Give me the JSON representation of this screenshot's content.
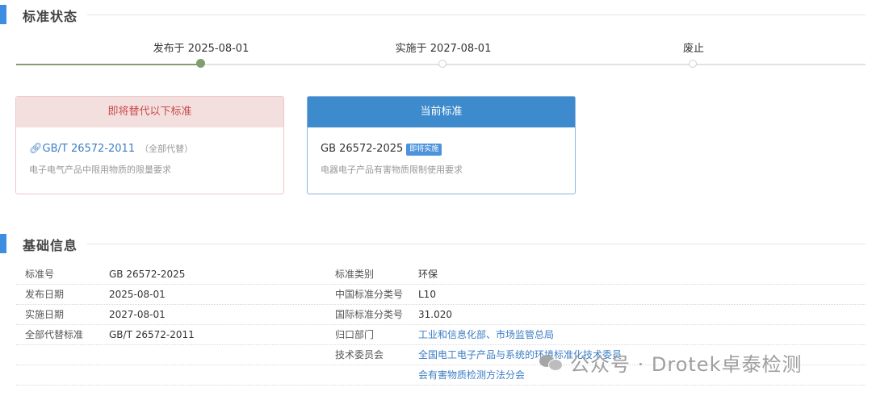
{
  "sections": {
    "status_title": "标准状态",
    "basic_title": "基础信息"
  },
  "timeline": {
    "steps": [
      {
        "label": "发布于 2025-08-01",
        "done": true
      },
      {
        "label": "实施于 2027-08-01",
        "done": false
      },
      {
        "label": "废止",
        "done": false
      }
    ]
  },
  "replace_card": {
    "header": "即将替代以下标准",
    "code": "GB/T 26572-2011",
    "note": "（全部代替）",
    "desc": "电子电气产品中限用物质的限量要求",
    "icon": "link-icon"
  },
  "current_card": {
    "header": "当前标准",
    "code": "GB 26572-2025",
    "badge": "即将实施",
    "desc": "电器电子产品有害物质限制使用要求"
  },
  "info": {
    "rows": [
      {
        "k1": "标准号",
        "v1": "GB 26572-2025",
        "k2": "标准类别",
        "v2": "环保"
      },
      {
        "k1": "发布日期",
        "v1": "2025-08-01",
        "k2": "中国标准分类号",
        "v2": "L10"
      },
      {
        "k1": "实施日期",
        "v1": "2027-08-01",
        "k2": "国际标准分类号",
        "v2": "31.020"
      },
      {
        "k1": "全部代替标准",
        "v1": "GB/T 26572-2011",
        "k2": "归口部门",
        "v2a": "工业和信息化部",
        "sep": "、",
        "v2b": "市场监管总局"
      },
      {
        "k1": "",
        "v1": "",
        "k2": "技术委员会",
        "v2": "全国电工电子产品与系统的环境标准化技术委员"
      },
      {
        "k1": "",
        "v1": "",
        "k2": "",
        "v2": "会有害物质检测方法分会"
      }
    ]
  },
  "watermark": {
    "text": "公众号 · Drotek卓泰检测",
    "icon": "wechat-icon"
  },
  "colors": {
    "accent": "#3d8ee0",
    "done": "#7f9f70",
    "replace_header_bg": "#f4dfdf",
    "replace_header_text": "#c94a4a",
    "current_header_bg": "#3d8acc",
    "link": "#3d7ec4"
  }
}
